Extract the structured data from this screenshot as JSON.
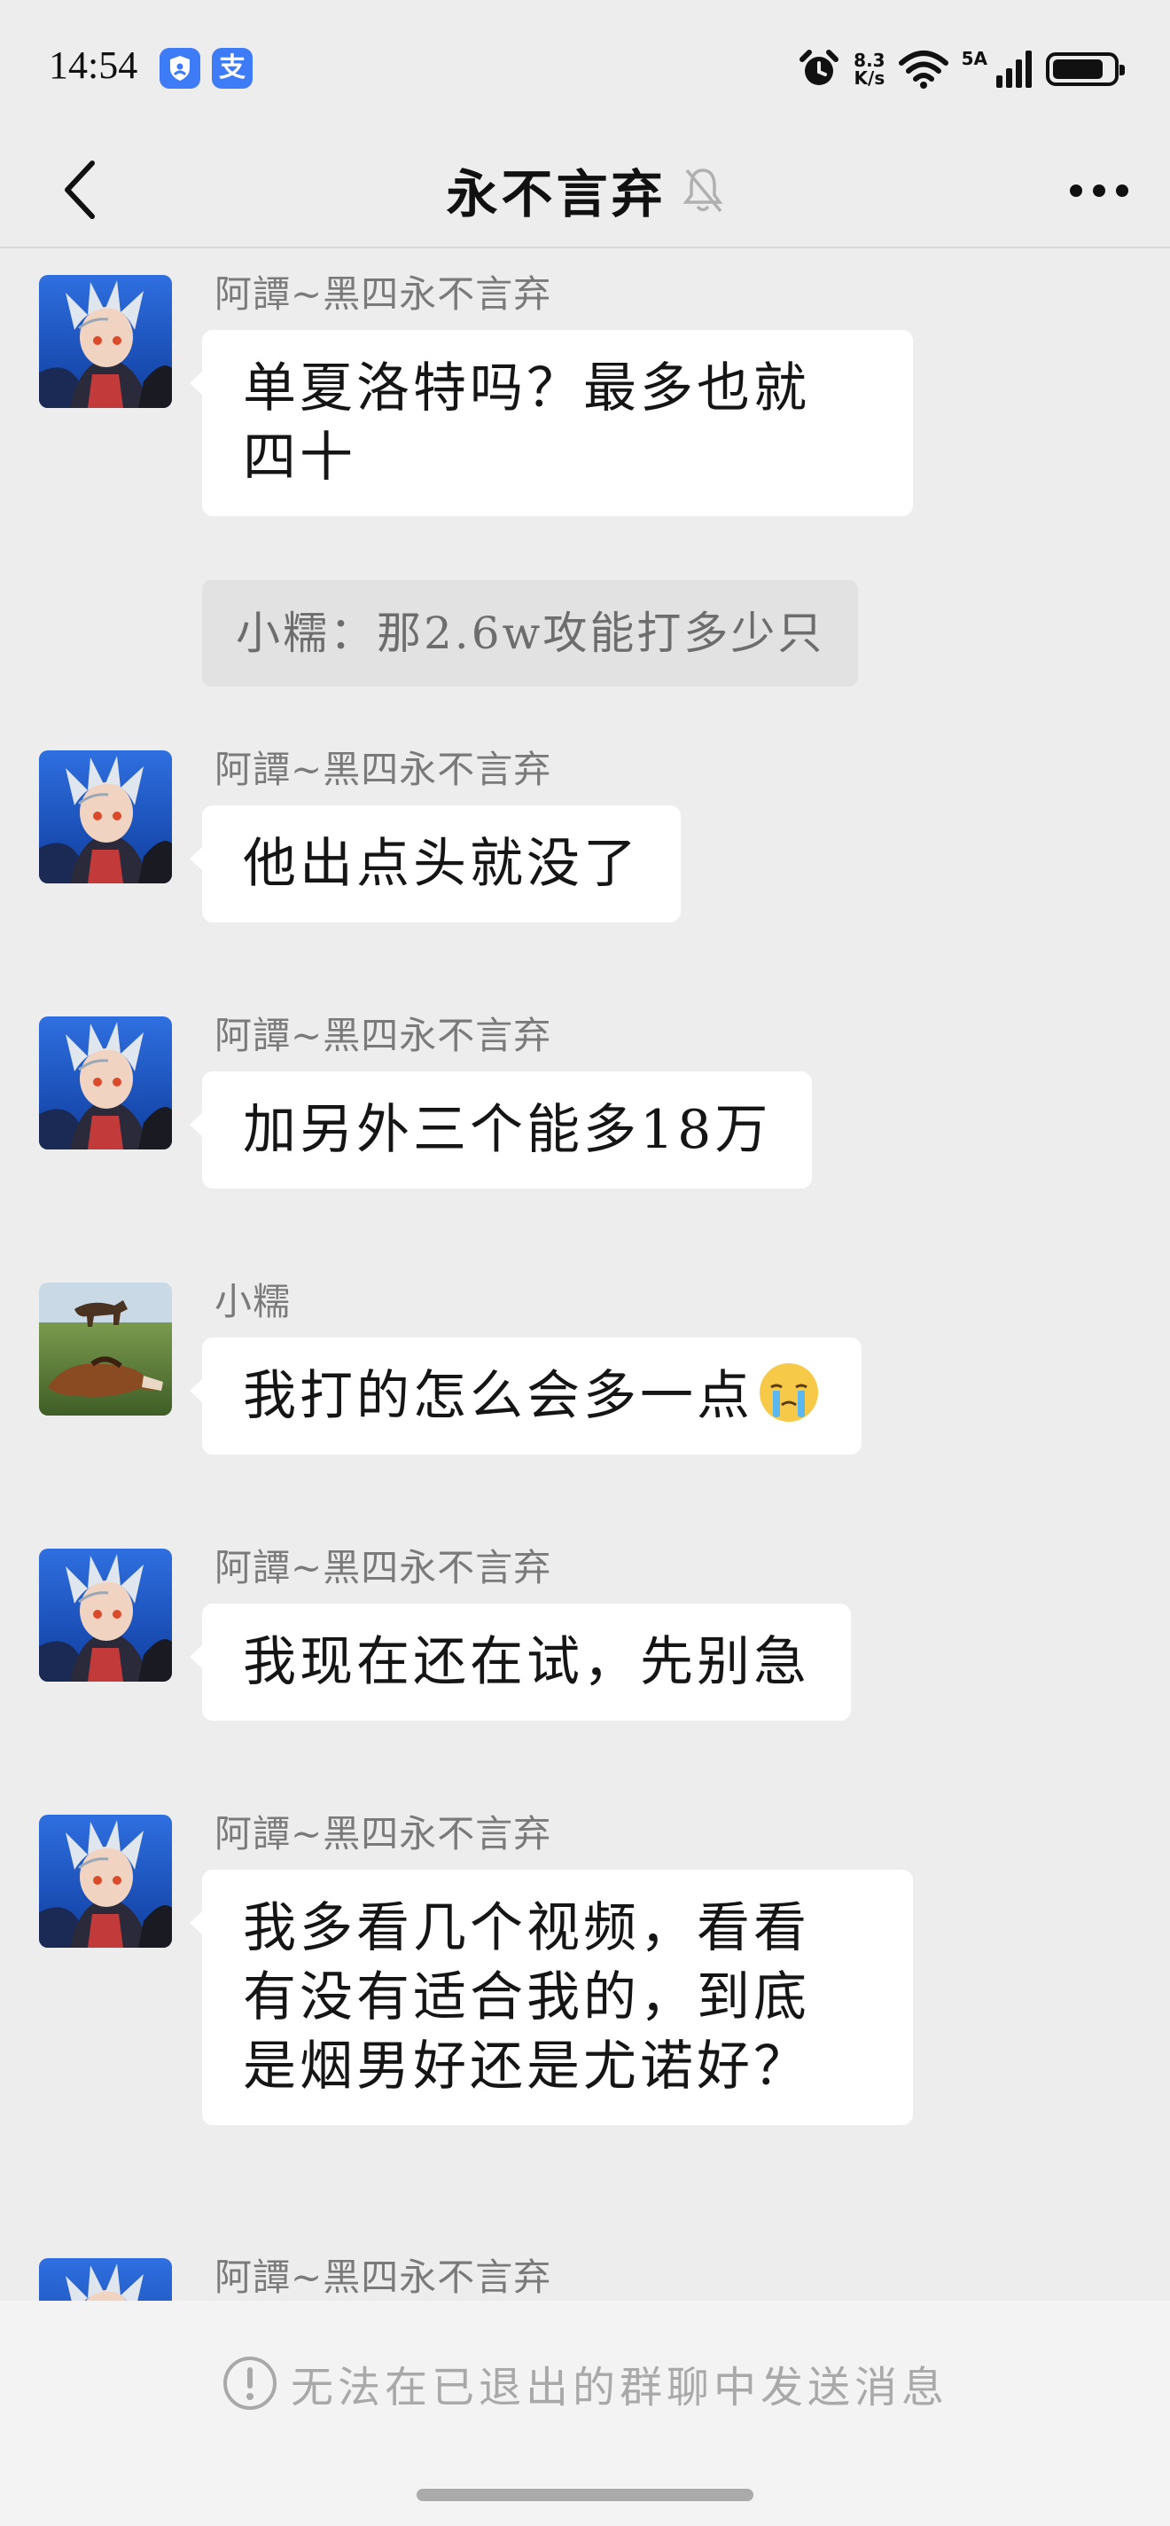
{
  "status_bar": {
    "time": "14:54",
    "app_icons": [
      "shield-app-icon",
      "alipay-icon"
    ],
    "alipay_glyph": "支",
    "net_speed_value": "8.3",
    "net_speed_unit": "K/s",
    "signal_label": "5A",
    "battery_level": 0.85
  },
  "header": {
    "title": "永不言弃",
    "back_icon": "chevron-left-icon",
    "mute_icon": "bell-muted-icon",
    "more_icon": "more-horizontal-icon"
  },
  "messages": [
    {
      "sender": "阿譚~黑四永不言弃",
      "lines": [
        "单夏洛特吗？最多也就",
        "四十"
      ],
      "quote": "小糯：那2.6w攻能打多少只"
    },
    {
      "sender": "阿譚~黑四永不言弃",
      "lines": [
        "他出点头就没了"
      ]
    },
    {
      "sender": "阿譚~黑四永不言弃",
      "lines": [
        "加另外三个能多18万"
      ]
    },
    {
      "sender": "小糯",
      "lines": [
        "我打的怎么会多一点"
      ],
      "emoji": "crying-face-emoji"
    },
    {
      "sender": "阿譚~黑四永不言弃",
      "lines": [
        "我现在还在试，先别急"
      ]
    },
    {
      "sender": "阿譚~黑四永不言弃",
      "lines": [
        "我多看几个视频，看看",
        "有没有适合我的，到底",
        "是烟男好还是尤诺好？"
      ]
    },
    {
      "sender": "阿譚~黑四永不言弃"
    }
  ],
  "footer": {
    "notice": "无法在已退出的群聊中发送消息",
    "notice_icon": "exclamation-circle-icon"
  },
  "colors": {
    "background": "#ededed",
    "bubble": "#ffffff",
    "quote": "#e2e2e2",
    "accent_badge": "#3d7bf7"
  }
}
